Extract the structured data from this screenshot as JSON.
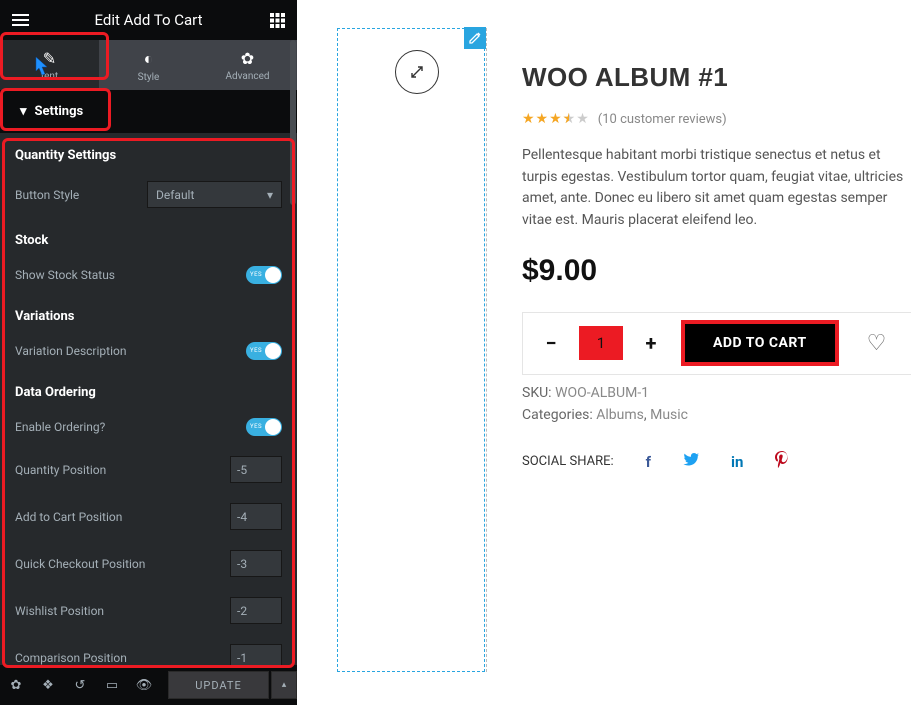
{
  "header": {
    "title": "Edit Add To Cart"
  },
  "tabs": {
    "content": "tent",
    "style": "Style",
    "advanced": "Advanced"
  },
  "section": {
    "settings": "Settings"
  },
  "groups": {
    "quantity": "Quantity Settings",
    "stock": "Stock",
    "variations": "Variations",
    "ordering": "Data Ordering"
  },
  "controls": {
    "button_style_label": "Button Style",
    "button_style_value": "Default",
    "show_stock_label": "Show Stock Status",
    "var_desc_label": "Variation Description",
    "enable_order_label": "Enable Ordering?",
    "qty_pos_label": "Quantity Position",
    "qty_pos_val": "-5",
    "atc_pos_label": "Add to Cart Position",
    "atc_pos_val": "-4",
    "qc_pos_label": "Quick Checkout Position",
    "qc_pos_val": "-3",
    "wish_pos_label": "Wishlist Position",
    "wish_pos_val": "-2",
    "comp_pos_label": "Comparison Position",
    "comp_pos_val": "-1"
  },
  "footer": {
    "update": "UPDATE"
  },
  "product": {
    "title": "WOO ALBUM #1",
    "reviews": "(10 customer reviews)",
    "desc": "Pellentesque habitant morbi tristique senectus et netus et turpis egestas. Vestibulum tortor quam, feugiat vitae, ultricies amet, ante. Donec eu libero sit amet quam egestas semper vitae est. Mauris placerat eleifend leo.",
    "price": "$9.00",
    "qty": "1",
    "atc": "ADD TO CART",
    "sku_label": "SKU:",
    "sku": "WOO-ALBUM-1",
    "cat_label": "Categories:",
    "cat1": "Albums",
    "cat2": "Music",
    "share_label": "SOCIAL SHARE:"
  }
}
